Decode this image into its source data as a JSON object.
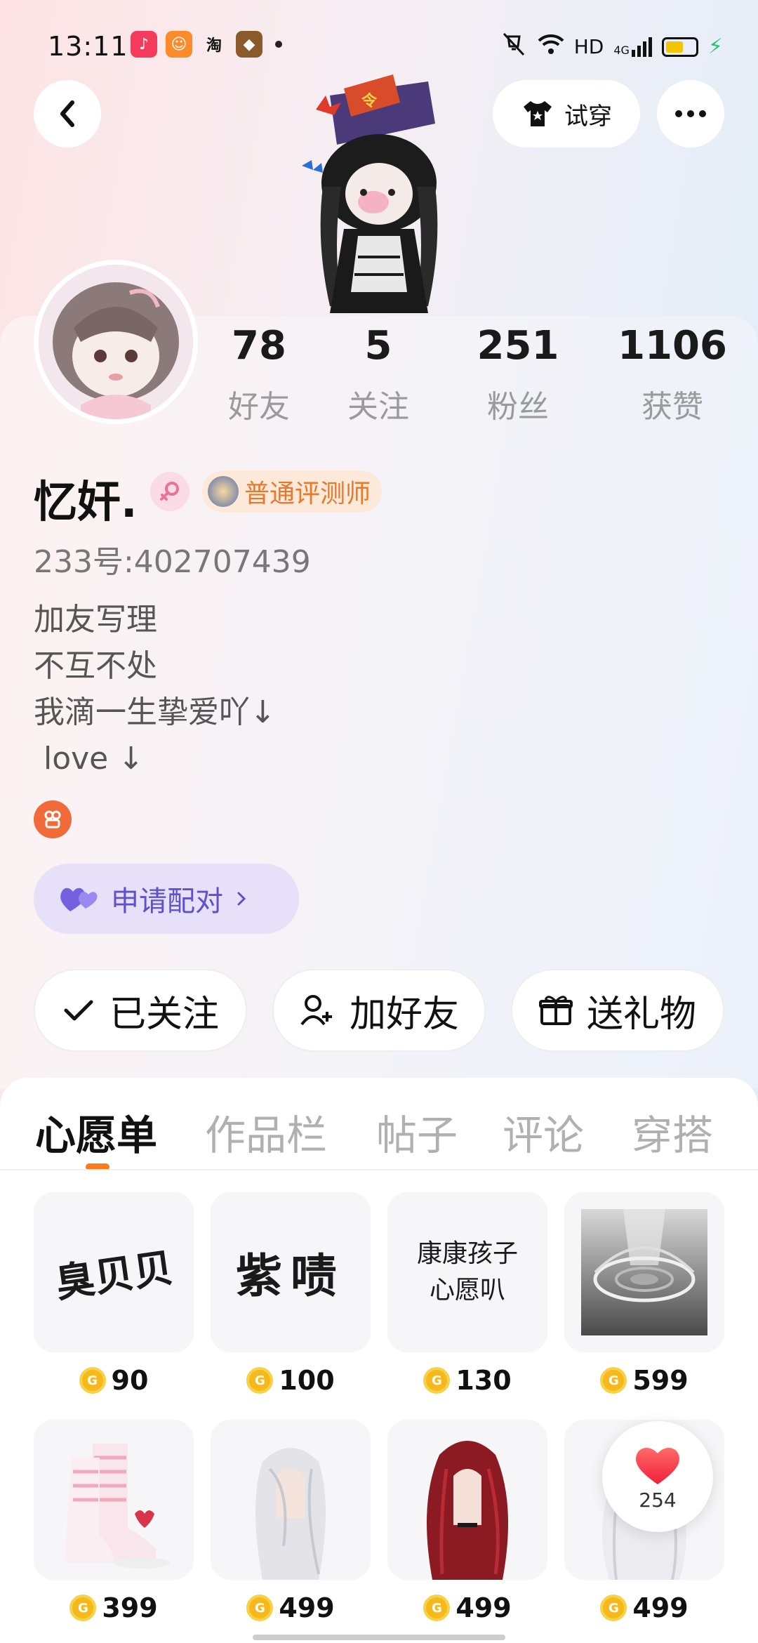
{
  "status_bar": {
    "time": "13:11",
    "hd": "HD",
    "signal": "4G"
  },
  "header": {
    "tryon_label": "试穿"
  },
  "profile": {
    "stats": [
      {
        "value": "78",
        "label": "好友"
      },
      {
        "value": "5",
        "label": "关注"
      },
      {
        "value": "251",
        "label": "粉丝"
      },
      {
        "value": "1106",
        "label": "获赞"
      }
    ],
    "username": "忆奸.",
    "title_badge": "普通评测师",
    "uid": "233号:402707439",
    "bio": [
      "加友写理",
      "不互不处",
      "我滴一生挚爱吖↓",
      " love ↓"
    ],
    "pair_button": "申请配对"
  },
  "actions": {
    "followed": "已关注",
    "add_friend": "加好友",
    "send_gift": "送礼物"
  },
  "tabs": [
    "心愿单",
    "作品栏",
    "帖子",
    "评论",
    "穿搭"
  ],
  "wishlist": [
    {
      "art_text": "臭贝贝",
      "price": "90"
    },
    {
      "art_text": "紫啧",
      "price": "100"
    },
    {
      "art_text": "康康孩子心愿叭",
      "price": "130"
    },
    {
      "art_text": "",
      "price": "599"
    },
    {
      "art_text": "",
      "price": "399"
    },
    {
      "art_text": "",
      "price": "499"
    },
    {
      "art_text": "",
      "price": "499"
    },
    {
      "art_text": "",
      "price": "499"
    }
  ],
  "like_float": {
    "count": "254"
  },
  "colors": {
    "accent_orange": "#ff7a1a",
    "pair_purple": "#6150c8",
    "coin_gold": "#f7b81c"
  }
}
